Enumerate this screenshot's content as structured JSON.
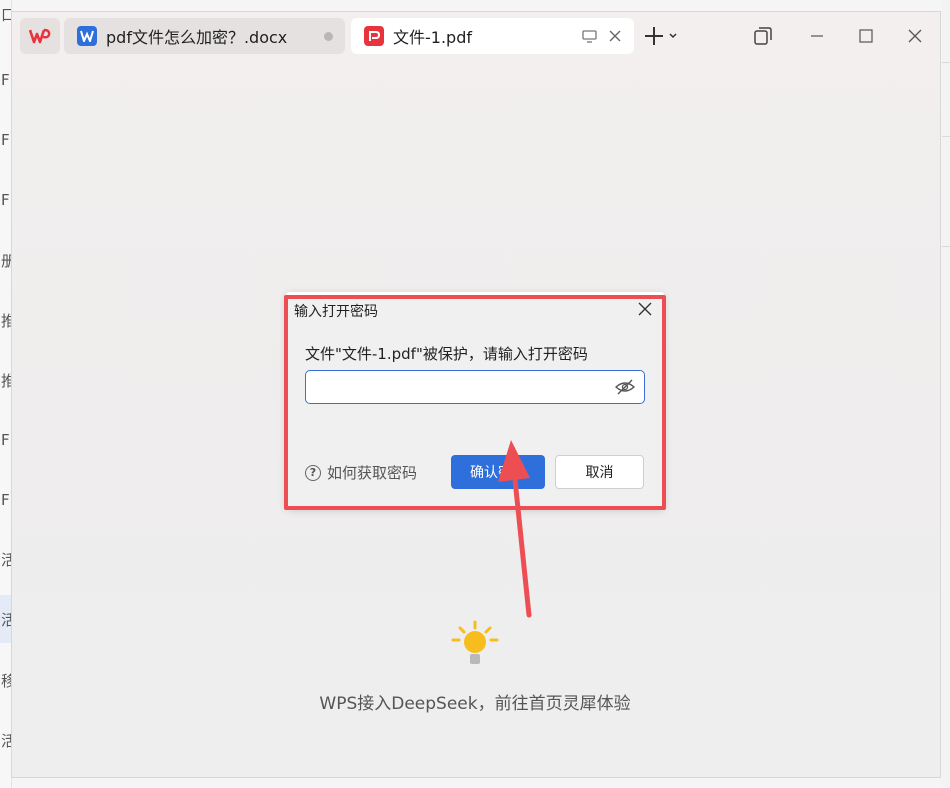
{
  "background_app": {
    "left_glyphs": [
      "口",
      "F",
      "F",
      "F",
      "册",
      "推",
      "推",
      "F",
      "F",
      "活",
      "活",
      "移",
      "活"
    ]
  },
  "titlebar": {
    "tabs": [
      {
        "label": "pdf文件怎么加密？.docx",
        "app": "wps-writer-icon",
        "active": false
      },
      {
        "label": "文件-1.pdf",
        "app": "wps-pdf-icon",
        "active": true
      }
    ]
  },
  "dialog": {
    "title": "输入打开密码",
    "prompt": "文件\"文件-1.pdf\"被保护，请输入打开密码",
    "password_value": "",
    "help_icon": "?",
    "help_label": "如何获取密码",
    "ok_label": "确认密码",
    "cancel_label": "取消"
  },
  "footer": {
    "message": "WPS接入DeepSeek，前往首页灵犀体验"
  },
  "colors": {
    "accent": "#2f6fdc",
    "annotation_red": "#ec4e54",
    "wps_red": "#e8323c",
    "writer_blue": "#2f6fdc",
    "bulb_yellow": "#f7bd1e"
  }
}
